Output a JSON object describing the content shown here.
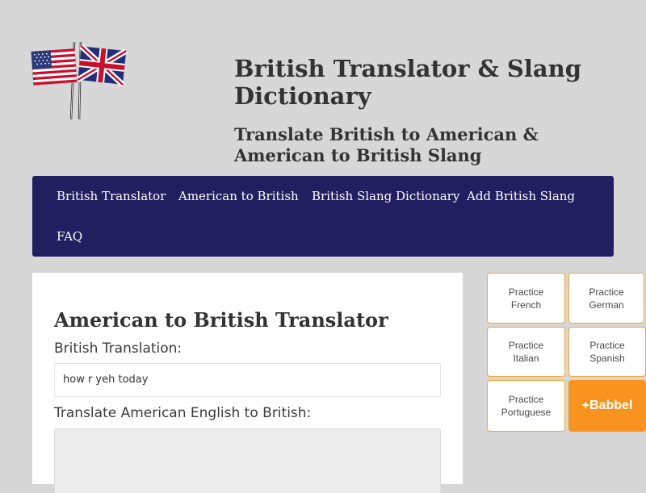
{
  "header": {
    "title": "British Translator & Slang Dictionary",
    "tagline": "Translate British to American & American to British Slang"
  },
  "nav": {
    "items": [
      {
        "label": "British Translator"
      },
      {
        "label": "American to British"
      },
      {
        "label": "British Slang Dictionary"
      },
      {
        "label": "Add British Slang"
      },
      {
        "label": "FAQ"
      }
    ]
  },
  "main": {
    "title": "American to British Translator",
    "output_label": "British Translation:",
    "output_value": "how r yeh today",
    "input_label": "Translate American English to British:",
    "input_value": ""
  },
  "ad": {
    "tiles": [
      {
        "line1": "Practice",
        "line2": "French"
      },
      {
        "line1": "Practice",
        "line2": "German"
      },
      {
        "line1": "Practice",
        "line2": "Italian"
      },
      {
        "line1": "Practice",
        "line2": "Spanish"
      },
      {
        "line1": "Practice",
        "line2": "Portuguese"
      }
    ],
    "brand": "+Babbel",
    "choices_icon": "ad-choices-icon"
  },
  "colors": {
    "page_bg": "#d7d7d7",
    "nav_bg": "#221f60",
    "ad_accent": "#f7931e",
    "ad_choices": "#00aecd"
  }
}
